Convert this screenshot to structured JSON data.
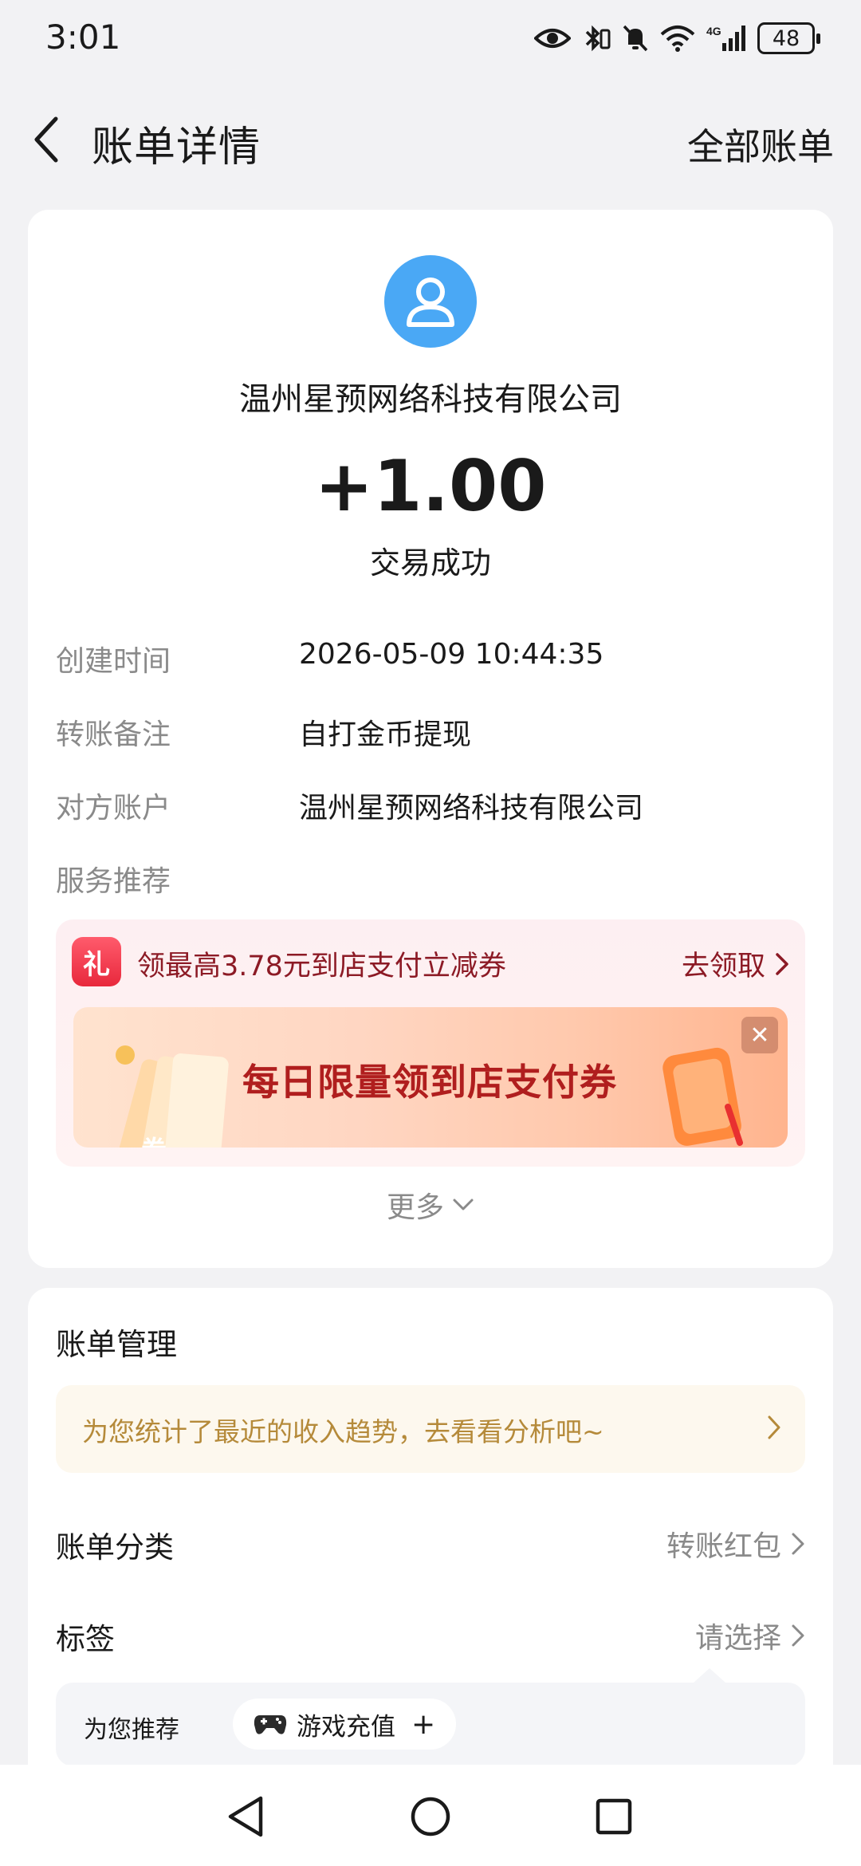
{
  "status_bar": {
    "time": "3:01",
    "battery": "48",
    "icons": [
      "eye-icon",
      "bluetooth-icon",
      "mute-icon",
      "wifi-icon",
      "signal-4g-icon",
      "battery-icon"
    ]
  },
  "header": {
    "title": "账单详情",
    "all_bills": "全部账单"
  },
  "transaction": {
    "payer": "温州星预网络科技有限公司",
    "amount": "+1.00",
    "status": "交易成功",
    "avatar_color": "#4aa8f5"
  },
  "details": [
    {
      "label": "创建时间",
      "value": "2026-05-09 10:44:35"
    },
    {
      "label": "转账备注",
      "value": "自打金币提现"
    },
    {
      "label": "对方账户",
      "value": "温州星预网络科技有限公司"
    },
    {
      "label": "服务推荐",
      "value": ""
    }
  ],
  "coupon": {
    "icon_text": "礼",
    "text": "领最高3.78元到店支付立减券",
    "cta": "去领取",
    "banner_text": "每日限量领到店支付券",
    "banner_deco_text": "券"
  },
  "more": "更多",
  "manage": {
    "title": "账单管理",
    "trend_text": "为您统计了最近的收入趋势，去看看分析吧~",
    "category_label": "账单分类",
    "category_value": "转账红包",
    "tag_label": "标签",
    "tag_value": "请选择",
    "recommend_label": "为您推荐",
    "recommend_chip": "游戏充值",
    "recommend_plus": "+"
  },
  "colors": {
    "accent_red": "#8c1a25",
    "banner_red": "#b01e1e",
    "gold": "#b58a3a",
    "muted": "#8a8a8a"
  }
}
